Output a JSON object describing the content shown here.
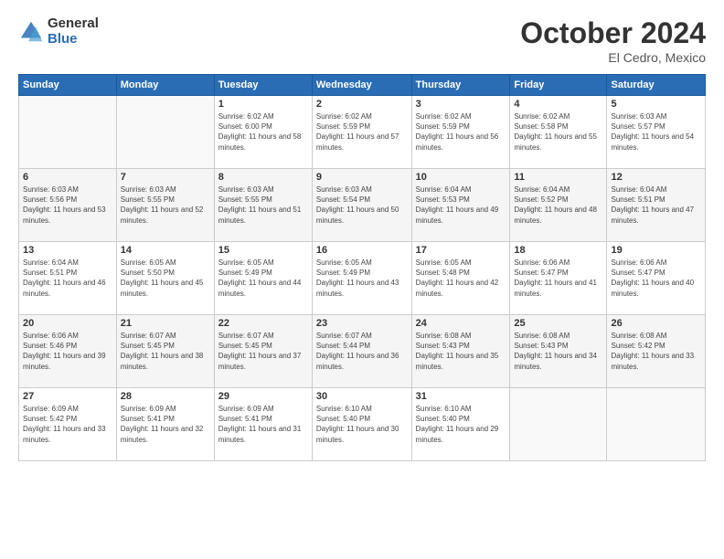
{
  "header": {
    "logo_general": "General",
    "logo_blue": "Blue",
    "month_title": "October 2024",
    "location": "El Cedro, Mexico"
  },
  "days_of_week": [
    "Sunday",
    "Monday",
    "Tuesday",
    "Wednesday",
    "Thursday",
    "Friday",
    "Saturday"
  ],
  "weeks": [
    [
      {
        "day": "",
        "info": ""
      },
      {
        "day": "",
        "info": ""
      },
      {
        "day": "1",
        "info": "Sunrise: 6:02 AM\nSunset: 6:00 PM\nDaylight: 11 hours and 58 minutes."
      },
      {
        "day": "2",
        "info": "Sunrise: 6:02 AM\nSunset: 5:59 PM\nDaylight: 11 hours and 57 minutes."
      },
      {
        "day": "3",
        "info": "Sunrise: 6:02 AM\nSunset: 5:59 PM\nDaylight: 11 hours and 56 minutes."
      },
      {
        "day": "4",
        "info": "Sunrise: 6:02 AM\nSunset: 5:58 PM\nDaylight: 11 hours and 55 minutes."
      },
      {
        "day": "5",
        "info": "Sunrise: 6:03 AM\nSunset: 5:57 PM\nDaylight: 11 hours and 54 minutes."
      }
    ],
    [
      {
        "day": "6",
        "info": "Sunrise: 6:03 AM\nSunset: 5:56 PM\nDaylight: 11 hours and 53 minutes."
      },
      {
        "day": "7",
        "info": "Sunrise: 6:03 AM\nSunset: 5:55 PM\nDaylight: 11 hours and 52 minutes."
      },
      {
        "day": "8",
        "info": "Sunrise: 6:03 AM\nSunset: 5:55 PM\nDaylight: 11 hours and 51 minutes."
      },
      {
        "day": "9",
        "info": "Sunrise: 6:03 AM\nSunset: 5:54 PM\nDaylight: 11 hours and 50 minutes."
      },
      {
        "day": "10",
        "info": "Sunrise: 6:04 AM\nSunset: 5:53 PM\nDaylight: 11 hours and 49 minutes."
      },
      {
        "day": "11",
        "info": "Sunrise: 6:04 AM\nSunset: 5:52 PM\nDaylight: 11 hours and 48 minutes."
      },
      {
        "day": "12",
        "info": "Sunrise: 6:04 AM\nSunset: 5:51 PM\nDaylight: 11 hours and 47 minutes."
      }
    ],
    [
      {
        "day": "13",
        "info": "Sunrise: 6:04 AM\nSunset: 5:51 PM\nDaylight: 11 hours and 46 minutes."
      },
      {
        "day": "14",
        "info": "Sunrise: 6:05 AM\nSunset: 5:50 PM\nDaylight: 11 hours and 45 minutes."
      },
      {
        "day": "15",
        "info": "Sunrise: 6:05 AM\nSunset: 5:49 PM\nDaylight: 11 hours and 44 minutes."
      },
      {
        "day": "16",
        "info": "Sunrise: 6:05 AM\nSunset: 5:49 PM\nDaylight: 11 hours and 43 minutes."
      },
      {
        "day": "17",
        "info": "Sunrise: 6:05 AM\nSunset: 5:48 PM\nDaylight: 11 hours and 42 minutes."
      },
      {
        "day": "18",
        "info": "Sunrise: 6:06 AM\nSunset: 5:47 PM\nDaylight: 11 hours and 41 minutes."
      },
      {
        "day": "19",
        "info": "Sunrise: 6:06 AM\nSunset: 5:47 PM\nDaylight: 11 hours and 40 minutes."
      }
    ],
    [
      {
        "day": "20",
        "info": "Sunrise: 6:06 AM\nSunset: 5:46 PM\nDaylight: 11 hours and 39 minutes."
      },
      {
        "day": "21",
        "info": "Sunrise: 6:07 AM\nSunset: 5:45 PM\nDaylight: 11 hours and 38 minutes."
      },
      {
        "day": "22",
        "info": "Sunrise: 6:07 AM\nSunset: 5:45 PM\nDaylight: 11 hours and 37 minutes."
      },
      {
        "day": "23",
        "info": "Sunrise: 6:07 AM\nSunset: 5:44 PM\nDaylight: 11 hours and 36 minutes."
      },
      {
        "day": "24",
        "info": "Sunrise: 6:08 AM\nSunset: 5:43 PM\nDaylight: 11 hours and 35 minutes."
      },
      {
        "day": "25",
        "info": "Sunrise: 6:08 AM\nSunset: 5:43 PM\nDaylight: 11 hours and 34 minutes."
      },
      {
        "day": "26",
        "info": "Sunrise: 6:08 AM\nSunset: 5:42 PM\nDaylight: 11 hours and 33 minutes."
      }
    ],
    [
      {
        "day": "27",
        "info": "Sunrise: 6:09 AM\nSunset: 5:42 PM\nDaylight: 11 hours and 33 minutes."
      },
      {
        "day": "28",
        "info": "Sunrise: 6:09 AM\nSunset: 5:41 PM\nDaylight: 11 hours and 32 minutes."
      },
      {
        "day": "29",
        "info": "Sunrise: 6:09 AM\nSunset: 5:41 PM\nDaylight: 11 hours and 31 minutes."
      },
      {
        "day": "30",
        "info": "Sunrise: 6:10 AM\nSunset: 5:40 PM\nDaylight: 11 hours and 30 minutes."
      },
      {
        "day": "31",
        "info": "Sunrise: 6:10 AM\nSunset: 5:40 PM\nDaylight: 11 hours and 29 minutes."
      },
      {
        "day": "",
        "info": ""
      },
      {
        "day": "",
        "info": ""
      }
    ]
  ]
}
